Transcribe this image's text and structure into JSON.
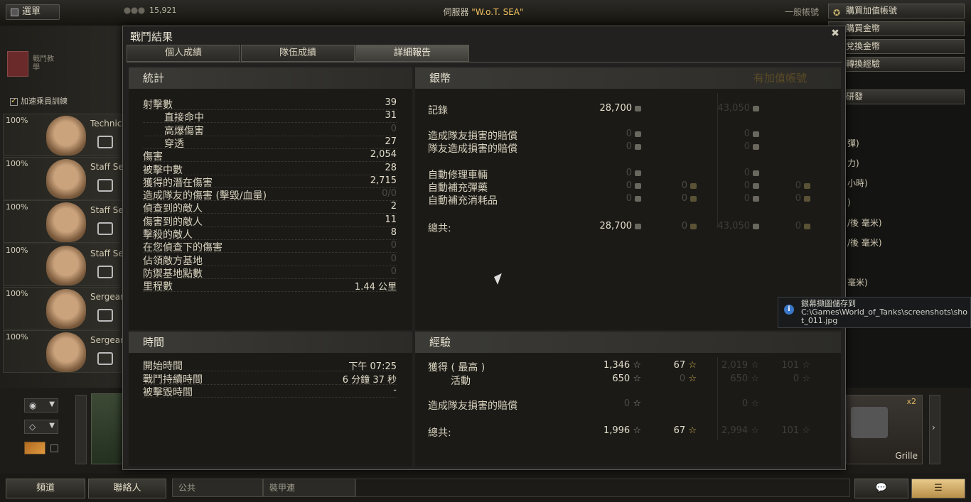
{
  "topbar": {
    "menu_label": "選單",
    "gold": "15,921",
    "server_prefix": "伺服器",
    "server_name": "\"W.o.T. SEA\"",
    "account_type": "一般帳號",
    "right_buttons": [
      "購買加值帳號",
      "購買金幣",
      "兌換金幣",
      "轉換經驗",
      "研發"
    ]
  },
  "sidebar": {
    "tutorial": "戰鬥教學",
    "accel_training": "加速乘員訓練",
    "crew": [
      {
        "pct": "100%",
        "rank": "Technica"
      },
      {
        "pct": "100%",
        "rank": "Staff Ser"
      },
      {
        "pct": "100%",
        "rank": "Staff Ser"
      },
      {
        "pct": "100%",
        "rank": "Staff Ser"
      },
      {
        "pct": "100%",
        "rank": "Sergeant"
      },
      {
        "pct": "100%",
        "rank": "Sergeant"
      }
    ]
  },
  "right_side": [
    "彈)",
    "力)",
    "小時)",
    ")",
    "/後 毫米)",
    "/後 毫米)",
    "毫米)"
  ],
  "dialog": {
    "title": "戰鬥結果",
    "tabs": [
      "個人成績",
      "隊伍成績",
      "詳細報告"
    ],
    "stats": {
      "header": "統計",
      "rows": [
        {
          "label": "射擊數",
          "value": "39"
        },
        {
          "label": "直接命中",
          "value": "31"
        },
        {
          "label": "高爆傷害",
          "value": "0"
        },
        {
          "label": "穿透",
          "value": "27"
        },
        {
          "label": "傷害",
          "value": "2,054"
        },
        {
          "label": "被擊中數",
          "value": "28"
        },
        {
          "label": "獲得的潛在傷害",
          "value": "2,715"
        },
        {
          "label": "造成隊友的傷害 (擊毀/血量)",
          "value": "0/0"
        },
        {
          "label": "偵查到的敵人",
          "value": "2"
        },
        {
          "label": "傷害到的敵人",
          "value": "11"
        },
        {
          "label": "擊殺的敵人",
          "value": "8"
        },
        {
          "label": "在您偵查下的傷害",
          "value": "0"
        },
        {
          "label": "佔領敵方基地",
          "value": "0"
        },
        {
          "label": "防禦基地點數",
          "value": "0"
        },
        {
          "label": "里程數",
          "value": "1.44 公里"
        }
      ]
    },
    "silver": {
      "header": "銀幣",
      "premium_header": "有加值帳號",
      "rows": [
        {
          "label": "記錄",
          "v1": "28,700",
          "v2": "",
          "p1": "43,050",
          "p2": ""
        },
        {
          "label": "造成隊友損害的賠償",
          "v1": "0",
          "v2": "",
          "p1": "0",
          "p2": ""
        },
        {
          "label": "隊友造成損害的賠償",
          "v1": "0",
          "v2": "",
          "p1": "0",
          "p2": ""
        },
        {
          "label": "自動修理車輛",
          "v1": "0",
          "v2": "",
          "p1": "0",
          "p2": ""
        },
        {
          "label": "自動補充彈藥",
          "v1": "0",
          "v2": "0",
          "p1": "0",
          "p2": "0"
        },
        {
          "label": "自動補充消耗品",
          "v1": "0",
          "v2": "0",
          "p1": "0",
          "p2": "0"
        },
        {
          "label": "總共:",
          "v1": "28,700",
          "v2": "0",
          "p1": "43,050",
          "p2": "0"
        }
      ]
    },
    "time": {
      "header": "時間",
      "rows": [
        {
          "label": "開始時間",
          "value": "下午 07:25"
        },
        {
          "label": "戰鬥持續時間",
          "value": "6 分鐘 37 秒"
        },
        {
          "label": "被擊毀時間",
          "value": "-"
        }
      ]
    },
    "exp": {
      "header": "經驗",
      "rows": [
        {
          "label": "獲得 ( 最高 )",
          "v1": "1,346",
          "v2": "67",
          "p1": "2,019",
          "p2": "101"
        },
        {
          "label": "活動",
          "v1": "650",
          "v2": "0",
          "p1": "650",
          "p2": "0"
        },
        {
          "label": "造成隊友損害的賠償",
          "v1": "0",
          "v2": "",
          "p1": "0",
          "p2": ""
        },
        {
          "label": "總共:",
          "v1": "1,996",
          "v2": "67",
          "p1": "2,994",
          "p2": "101"
        }
      ]
    }
  },
  "toast": {
    "text": "銀幕擷圖儲存到",
    "path": "C:\\Games\\World_of_Tanks\\screenshots\\shot_011.jpg"
  },
  "carousel": {
    "tank_name": "Grille",
    "multiplier": "x2"
  },
  "footer": {
    "channels": "頻道",
    "contacts": "聯絡人",
    "tab_public": "公共",
    "tab_company": "裝甲連"
  }
}
